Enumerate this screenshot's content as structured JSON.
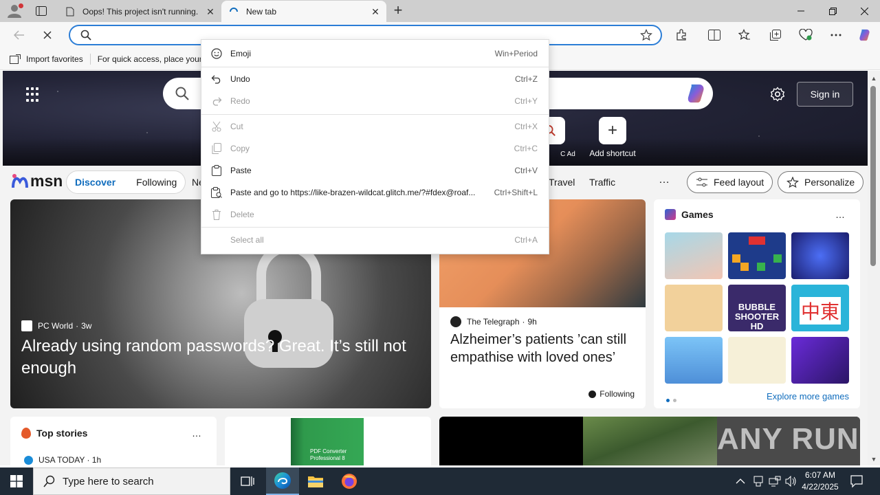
{
  "browser": {
    "tabs": [
      {
        "title": "Oops! This project isn't running.",
        "active": false
      },
      {
        "title": "New tab",
        "active": true
      }
    ],
    "address": {
      "value": "",
      "placeholder": ""
    },
    "favorites_bar": {
      "import_label": "Import favorites",
      "hint": "For quick access, place your"
    }
  },
  "page": {
    "signin_label": "Sign in",
    "shortcuts": [
      {
        "label": "C Ad"
      },
      {
        "label": "Add shortcut"
      }
    ],
    "logo_text": "msn",
    "nav": {
      "pill": [
        "Discover",
        "Following"
      ],
      "links": [
        "Ne",
        "Travel",
        "Traffic"
      ],
      "more": "…",
      "feed_layout": "Feed layout",
      "personalize": "Personalize"
    },
    "main_story": {
      "source": "PC World",
      "age": "3w",
      "headline": "Already using random passwords? Great. It’s still not enough"
    },
    "telegraph_story": {
      "source": "The Telegraph",
      "age": "9h",
      "headline": "Alzheimer’s patients ’can still empathise with loved ones’",
      "following_label": "Following"
    },
    "games": {
      "title": "Games",
      "more": "…",
      "explore_label": "Explore more games",
      "tile_texts": [
        "BUBBLE SHOOTER HD",
        "中東"
      ]
    },
    "top_stories": {
      "title": "Top stories",
      "more": "…",
      "first_item": "USA TODAY · 1h"
    },
    "pdf_ad": {
      "text": "PDF Converter Professional 8"
    },
    "watermark": "ANY RUN"
  },
  "context_menu": {
    "items": [
      {
        "label": "Emoji",
        "shortcut": "Win+Period",
        "enabled": true,
        "icon": "emoji-icon"
      },
      {
        "label": "Undo",
        "shortcut": "Ctrl+Z",
        "enabled": true,
        "icon": "undo-icon"
      },
      {
        "label": "Redo",
        "shortcut": "Ctrl+Y",
        "enabled": false,
        "icon": "redo-icon"
      },
      {
        "label": "Cut",
        "shortcut": "Ctrl+X",
        "enabled": false,
        "icon": "cut-icon"
      },
      {
        "label": "Copy",
        "shortcut": "Ctrl+C",
        "enabled": false,
        "icon": "copy-icon"
      },
      {
        "label": "Paste",
        "shortcut": "Ctrl+V",
        "enabled": true,
        "icon": "paste-icon"
      },
      {
        "label": "Paste and go to https://like-brazen-wildcat.glitch.me/?#fdex@roaf...",
        "shortcut": "Ctrl+Shift+L",
        "enabled": true,
        "icon": "paste-go-icon"
      },
      {
        "label": "Delete",
        "shortcut": "",
        "enabled": false,
        "icon": "delete-icon"
      },
      {
        "label": "Select all",
        "shortcut": "Ctrl+A",
        "enabled": false,
        "icon": ""
      }
    ]
  },
  "taskbar": {
    "search_placeholder": "Type here to search",
    "time": "6:07 AM",
    "date": "4/22/2025"
  },
  "colors": {
    "accent": "#0f6cbd",
    "address_border": "#2b7dd6",
    "taskbar": "#1f2a36"
  }
}
